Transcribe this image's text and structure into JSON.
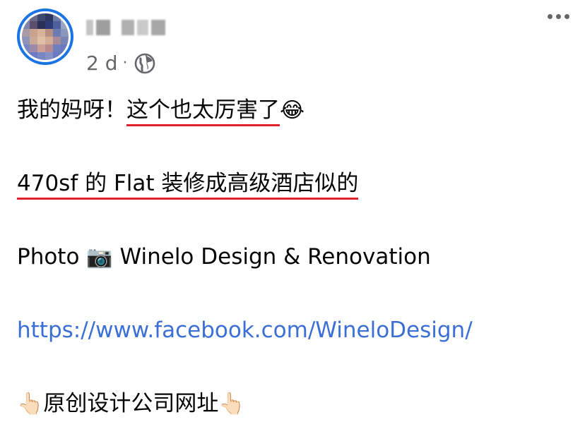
{
  "post": {
    "author_name": "",
    "timestamp": "2 d",
    "separator": "·",
    "privacy_icon": "globe-icon",
    "more_icon": "more-dots-icon",
    "text": {
      "line1_plain": "我的妈呀！",
      "line1_underlined": "这个也太厉害了",
      "line1_emoji": "😂",
      "line2_underlined": "470sf 的 Flat 装修成高级酒店似的",
      "line3_prefix": "Photo",
      "line3_emoji": "📷",
      "line3_suffix": "Winelo Design & Renovation",
      "line4_link": "https://www.facebook.com/WineloDesign/",
      "line5_emoji_left": "👆🏻",
      "line5_text": "原创设计公司网址",
      "line5_emoji_right": "👆🏻"
    }
  },
  "colors": {
    "accent_ring": "#1b74e4",
    "link": "#3b6fd6",
    "underline": "#e41e2b",
    "meta_gray": "#65676b"
  }
}
